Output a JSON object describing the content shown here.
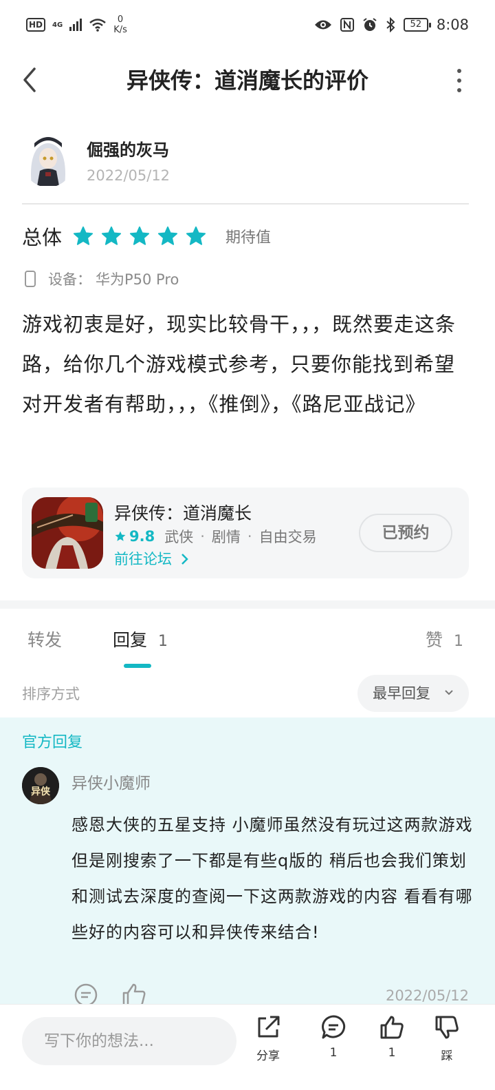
{
  "status_bar": {
    "hd": "HD",
    "network": "4G",
    "net_speed_value": "0",
    "net_speed_unit": "K/s",
    "battery": "52",
    "time": "8:08"
  },
  "header": {
    "title": "异侠传：道消魔长的评价"
  },
  "review": {
    "author_name": "倔强的灰马",
    "date": "2022/05/12",
    "rating_label": "总体",
    "rating_stars": 5,
    "rating_tag": "期待值",
    "device_label": "设备：",
    "device_name": "华为P50 Pro",
    "body": "游戏初衷是好，现实比较骨干，，，既然要走这条路，给你几个游戏模式参考，只要你能找到希望对开发者有帮助，，，《推倒》，《路尼亚战记》"
  },
  "game_card": {
    "name": "异侠传：道消魔长",
    "score": "9.8",
    "tags": [
      "武侠",
      "剧情",
      "自由交易"
    ],
    "forum_link": "前往论坛",
    "reserve_button": "已预约"
  },
  "tabs": {
    "forward": "转发",
    "reply": "回复",
    "reply_count": "1",
    "like": "赞",
    "like_count": "1"
  },
  "sort": {
    "label": "排序方式",
    "selected": "最早回复"
  },
  "official_reply": {
    "section_label": "官方回复",
    "author_name": "异侠小魔师",
    "avatar_text": "异侠",
    "text": "感恩大侠的五星支持 小魔师虽然没有玩过这两款游戏 但是刚搜索了一下都是有些q版的 稍后也会我们策划和测试去深度的查阅一下这两款游戏的内容 看看有哪些好的内容可以和异侠传来结合!",
    "date": "2022/05/12"
  },
  "bottom_bar": {
    "input_placeholder": "写下你的想法...",
    "share_label": "分享",
    "comment_count": "1",
    "like_count": "1",
    "dislike_label": "踩"
  },
  "colors": {
    "accent": "#14b8c4",
    "official_bg": "#e9f8f9"
  }
}
